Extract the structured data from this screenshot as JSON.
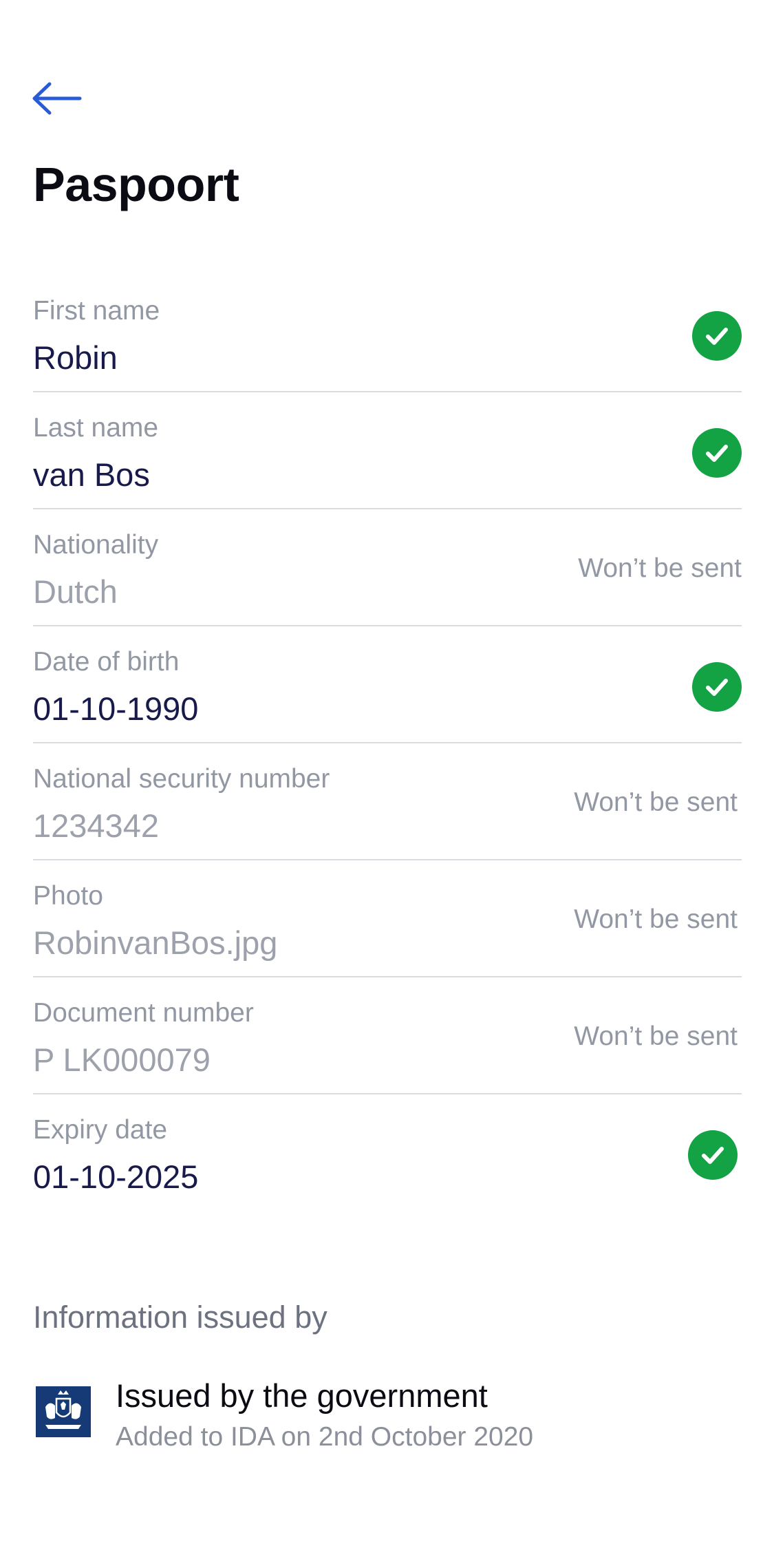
{
  "header": {
    "title": "Paspoort"
  },
  "fields": [
    {
      "label": "First name",
      "value": "Robin",
      "status": "check"
    },
    {
      "label": "Last name",
      "value": "van Bos",
      "status": "check"
    },
    {
      "label": "Nationality",
      "value": "Dutch",
      "status": "Won’t be sent"
    },
    {
      "label": "Date of birth",
      "value": "01-10-1990",
      "status": "check"
    },
    {
      "label": "National security number",
      "value": "1234342",
      "status": "Won’t be sent"
    },
    {
      "label": "Photo",
      "value": "RobinvanBos.jpg",
      "status": "Won’t be sent"
    },
    {
      "label": "Document number",
      "value": "P LK000079",
      "status": "Won’t be sent"
    },
    {
      "label": "Expiry date",
      "value": "01-10-2025",
      "status": "check"
    }
  ],
  "issued": {
    "heading": "Information issued by",
    "issuer_name": "Issued by the government",
    "added_text": "Added to IDA on 2nd October 2020"
  },
  "colors": {
    "accent": "#2a5bd7",
    "check": "#13a244",
    "value_active": "#171a4a",
    "value_muted": "#9ca1ab"
  }
}
